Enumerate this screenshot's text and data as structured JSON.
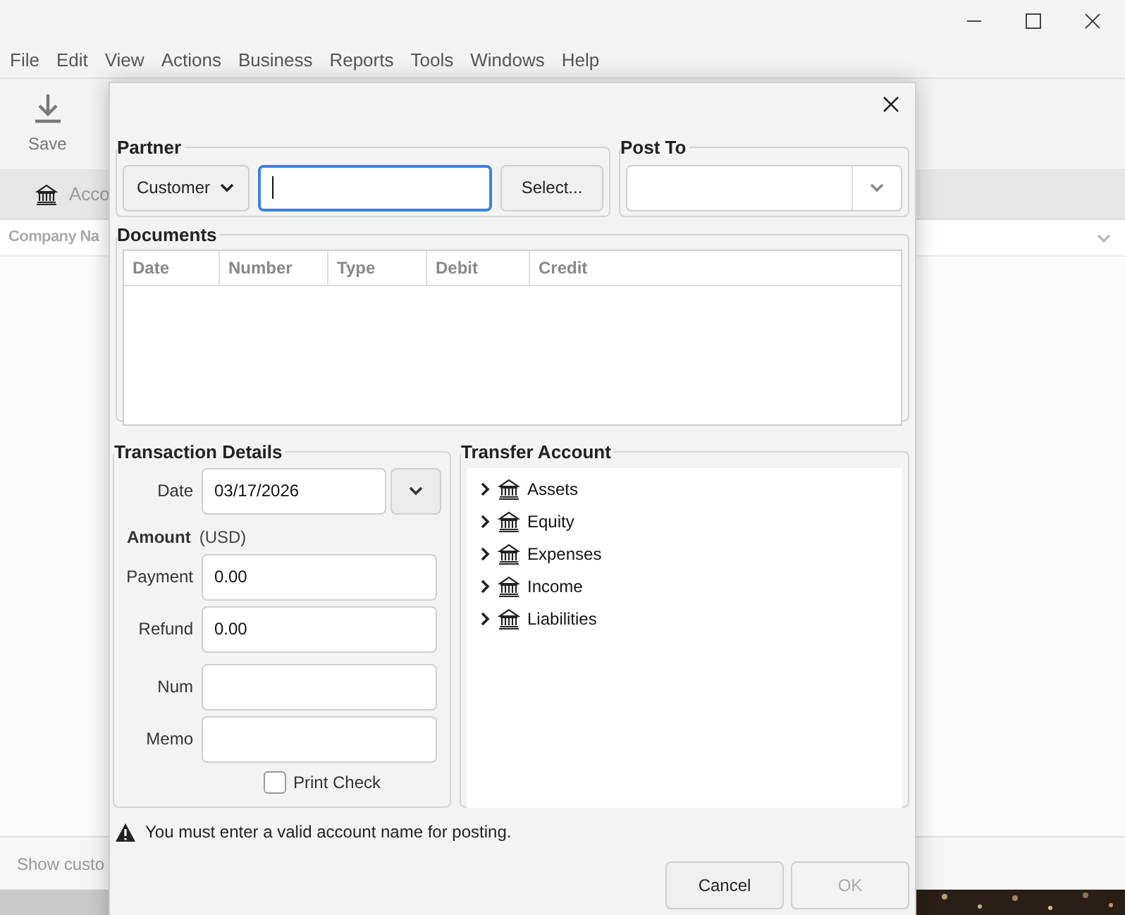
{
  "app": {
    "menu": [
      "File",
      "Edit",
      "View",
      "Actions",
      "Business",
      "Reports",
      "Tools",
      "Windows",
      "Help"
    ],
    "toolbar": [
      {
        "label": "Save"
      }
    ],
    "tab": {
      "label": "Acco"
    },
    "columns": [
      {
        "label": "Company Na"
      }
    ],
    "footer": {
      "label": "Show custo"
    }
  },
  "dialog": {
    "partner": {
      "title": "Partner",
      "type_button": "Customer",
      "name_field": {
        "focused": true
      },
      "select_button": "Select..."
    },
    "post_to": {
      "title": "Post To"
    },
    "documents": {
      "title": "Documents",
      "columns": [
        "Date",
        "Number",
        "Type",
        "Debit",
        "Credit"
      ]
    },
    "transaction_details": {
      "title": "Transaction Details",
      "date": {
        "label": "Date",
        "value": "03/17/2026"
      },
      "amount": {
        "label": "Amount",
        "currency": "(USD)"
      },
      "fields": [
        {
          "label": "Payment",
          "value": "0.00"
        },
        {
          "label": "Refund",
          "value": "0.00"
        },
        {
          "label": "Num"
        },
        {
          "label": "Memo"
        }
      ],
      "print_check": {
        "label": "Print Check",
        "checked": false
      }
    },
    "transfer_account": {
      "title": "Transfer Account",
      "items": [
        {
          "label": "Assets",
          "expanded": false
        },
        {
          "label": "Equity",
          "expanded": false
        },
        {
          "label": "Expenses",
          "expanded": false
        },
        {
          "label": "Income",
          "expanded": false
        },
        {
          "label": "Liabilities",
          "expanded": false
        }
      ]
    },
    "warning": "You must enter a valid account name for posting.",
    "buttons": [
      {
        "label": "Cancel",
        "disabled": false
      },
      {
        "label": "OK",
        "disabled": true
      }
    ]
  }
}
